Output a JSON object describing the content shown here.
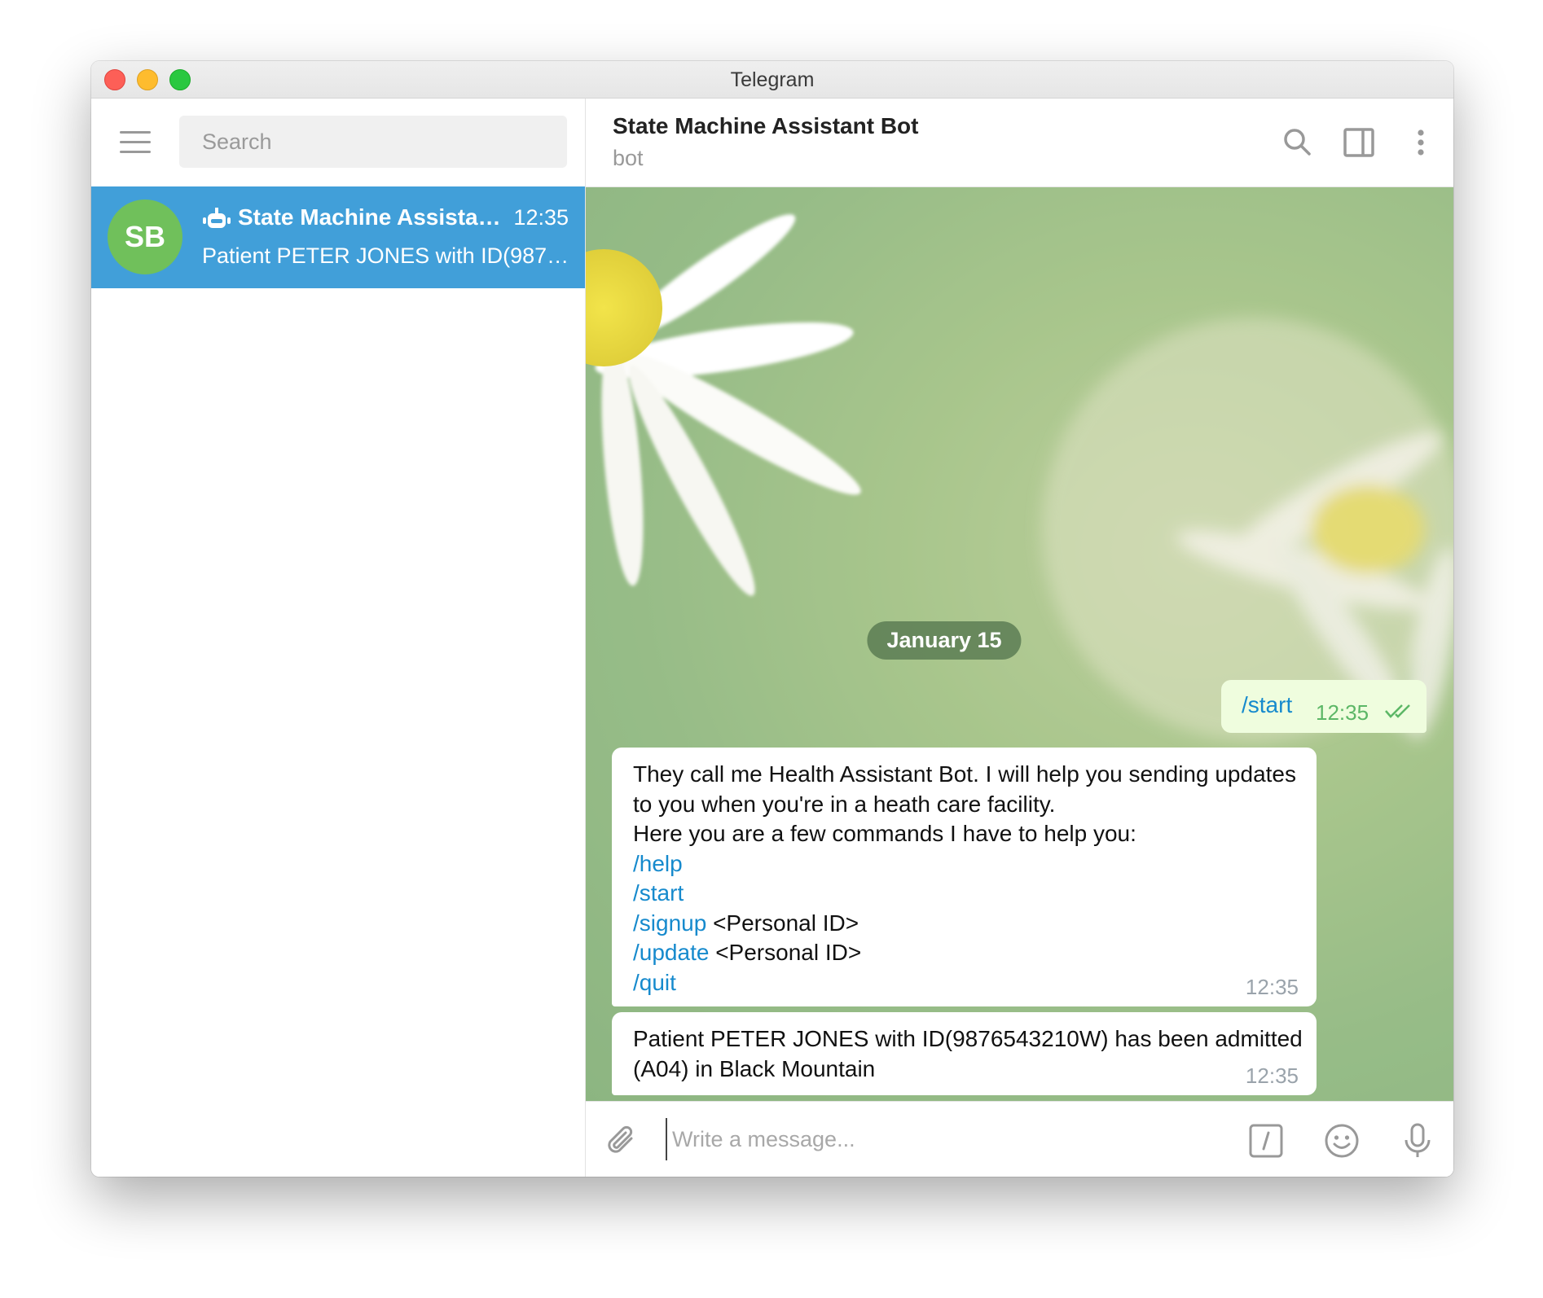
{
  "window": {
    "title": "Telegram"
  },
  "sidebar": {
    "search_placeholder": "Search",
    "chats": [
      {
        "avatar_initials": "SB",
        "name": "State Machine Assistant ...",
        "time": "12:35",
        "preview": "Patient PETER JONES with ID(98765..."
      }
    ]
  },
  "header": {
    "title": "State Machine Assistant Bot",
    "status": "bot"
  },
  "chat": {
    "date": "January 15",
    "messages": [
      {
        "direction": "out",
        "text": "/start",
        "time": "12:35",
        "status_icon": "double-check-icon"
      },
      {
        "direction": "in",
        "time": "12:35",
        "lines": [
          {
            "text": "They call me Health Assistant Bot. I will help you sending updates"
          },
          {
            "text": "to you when you're in a heath care facility."
          },
          {
            "text": "Here you are a few commands I have to help you:"
          },
          {
            "command": "/help"
          },
          {
            "command": "/start"
          },
          {
            "command": "/signup",
            "text": " <Personal ID>"
          },
          {
            "command": "/update",
            "text": " <Personal ID>"
          },
          {
            "command": "/quit"
          }
        ]
      },
      {
        "direction": "in",
        "time": "12:35",
        "lines": [
          {
            "text": "Patient PETER JONES with ID(9876543210W) has been admitted"
          },
          {
            "text": "(A04) in Black Mountain"
          }
        ]
      }
    ]
  },
  "input": {
    "placeholder": "Write a message..."
  },
  "colors": {
    "accent": "#419fd9",
    "avatar": "#70c05b",
    "command_link": "#168acd",
    "outgoing_bubble": "#effdde"
  }
}
